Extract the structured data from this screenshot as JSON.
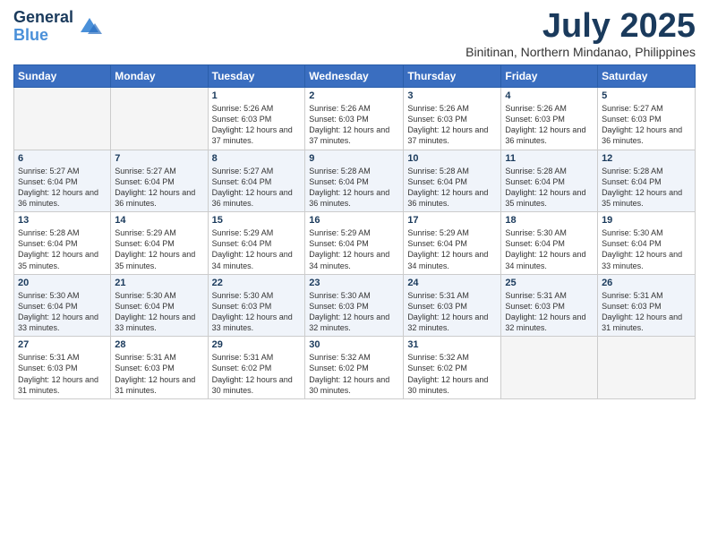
{
  "logo": {
    "line1": "General",
    "line2": "Blue"
  },
  "title": "July 2025",
  "location": "Binitinan, Northern Mindanao, Philippines",
  "weekdays": [
    "Sunday",
    "Monday",
    "Tuesday",
    "Wednesday",
    "Thursday",
    "Friday",
    "Saturday"
  ],
  "weeks": [
    [
      {
        "day": "",
        "sunrise": "",
        "sunset": "",
        "daylight": ""
      },
      {
        "day": "",
        "sunrise": "",
        "sunset": "",
        "daylight": ""
      },
      {
        "day": "1",
        "sunrise": "Sunrise: 5:26 AM",
        "sunset": "Sunset: 6:03 PM",
        "daylight": "Daylight: 12 hours and 37 minutes."
      },
      {
        "day": "2",
        "sunrise": "Sunrise: 5:26 AM",
        "sunset": "Sunset: 6:03 PM",
        "daylight": "Daylight: 12 hours and 37 minutes."
      },
      {
        "day": "3",
        "sunrise": "Sunrise: 5:26 AM",
        "sunset": "Sunset: 6:03 PM",
        "daylight": "Daylight: 12 hours and 37 minutes."
      },
      {
        "day": "4",
        "sunrise": "Sunrise: 5:26 AM",
        "sunset": "Sunset: 6:03 PM",
        "daylight": "Daylight: 12 hours and 36 minutes."
      },
      {
        "day": "5",
        "sunrise": "Sunrise: 5:27 AM",
        "sunset": "Sunset: 6:03 PM",
        "daylight": "Daylight: 12 hours and 36 minutes."
      }
    ],
    [
      {
        "day": "6",
        "sunrise": "Sunrise: 5:27 AM",
        "sunset": "Sunset: 6:04 PM",
        "daylight": "Daylight: 12 hours and 36 minutes."
      },
      {
        "day": "7",
        "sunrise": "Sunrise: 5:27 AM",
        "sunset": "Sunset: 6:04 PM",
        "daylight": "Daylight: 12 hours and 36 minutes."
      },
      {
        "day": "8",
        "sunrise": "Sunrise: 5:27 AM",
        "sunset": "Sunset: 6:04 PM",
        "daylight": "Daylight: 12 hours and 36 minutes."
      },
      {
        "day": "9",
        "sunrise": "Sunrise: 5:28 AM",
        "sunset": "Sunset: 6:04 PM",
        "daylight": "Daylight: 12 hours and 36 minutes."
      },
      {
        "day": "10",
        "sunrise": "Sunrise: 5:28 AM",
        "sunset": "Sunset: 6:04 PM",
        "daylight": "Daylight: 12 hours and 36 minutes."
      },
      {
        "day": "11",
        "sunrise": "Sunrise: 5:28 AM",
        "sunset": "Sunset: 6:04 PM",
        "daylight": "Daylight: 12 hours and 35 minutes."
      },
      {
        "day": "12",
        "sunrise": "Sunrise: 5:28 AM",
        "sunset": "Sunset: 6:04 PM",
        "daylight": "Daylight: 12 hours and 35 minutes."
      }
    ],
    [
      {
        "day": "13",
        "sunrise": "Sunrise: 5:28 AM",
        "sunset": "Sunset: 6:04 PM",
        "daylight": "Daylight: 12 hours and 35 minutes."
      },
      {
        "day": "14",
        "sunrise": "Sunrise: 5:29 AM",
        "sunset": "Sunset: 6:04 PM",
        "daylight": "Daylight: 12 hours and 35 minutes."
      },
      {
        "day": "15",
        "sunrise": "Sunrise: 5:29 AM",
        "sunset": "Sunset: 6:04 PM",
        "daylight": "Daylight: 12 hours and 34 minutes."
      },
      {
        "day": "16",
        "sunrise": "Sunrise: 5:29 AM",
        "sunset": "Sunset: 6:04 PM",
        "daylight": "Daylight: 12 hours and 34 minutes."
      },
      {
        "day": "17",
        "sunrise": "Sunrise: 5:29 AM",
        "sunset": "Sunset: 6:04 PM",
        "daylight": "Daylight: 12 hours and 34 minutes."
      },
      {
        "day": "18",
        "sunrise": "Sunrise: 5:30 AM",
        "sunset": "Sunset: 6:04 PM",
        "daylight": "Daylight: 12 hours and 34 minutes."
      },
      {
        "day": "19",
        "sunrise": "Sunrise: 5:30 AM",
        "sunset": "Sunset: 6:04 PM",
        "daylight": "Daylight: 12 hours and 33 minutes."
      }
    ],
    [
      {
        "day": "20",
        "sunrise": "Sunrise: 5:30 AM",
        "sunset": "Sunset: 6:04 PM",
        "daylight": "Daylight: 12 hours and 33 minutes."
      },
      {
        "day": "21",
        "sunrise": "Sunrise: 5:30 AM",
        "sunset": "Sunset: 6:04 PM",
        "daylight": "Daylight: 12 hours and 33 minutes."
      },
      {
        "day": "22",
        "sunrise": "Sunrise: 5:30 AM",
        "sunset": "Sunset: 6:03 PM",
        "daylight": "Daylight: 12 hours and 33 minutes."
      },
      {
        "day": "23",
        "sunrise": "Sunrise: 5:30 AM",
        "sunset": "Sunset: 6:03 PM",
        "daylight": "Daylight: 12 hours and 32 minutes."
      },
      {
        "day": "24",
        "sunrise": "Sunrise: 5:31 AM",
        "sunset": "Sunset: 6:03 PM",
        "daylight": "Daylight: 12 hours and 32 minutes."
      },
      {
        "day": "25",
        "sunrise": "Sunrise: 5:31 AM",
        "sunset": "Sunset: 6:03 PM",
        "daylight": "Daylight: 12 hours and 32 minutes."
      },
      {
        "day": "26",
        "sunrise": "Sunrise: 5:31 AM",
        "sunset": "Sunset: 6:03 PM",
        "daylight": "Daylight: 12 hours and 31 minutes."
      }
    ],
    [
      {
        "day": "27",
        "sunrise": "Sunrise: 5:31 AM",
        "sunset": "Sunset: 6:03 PM",
        "daylight": "Daylight: 12 hours and 31 minutes."
      },
      {
        "day": "28",
        "sunrise": "Sunrise: 5:31 AM",
        "sunset": "Sunset: 6:03 PM",
        "daylight": "Daylight: 12 hours and 31 minutes."
      },
      {
        "day": "29",
        "sunrise": "Sunrise: 5:31 AM",
        "sunset": "Sunset: 6:02 PM",
        "daylight": "Daylight: 12 hours and 30 minutes."
      },
      {
        "day": "30",
        "sunrise": "Sunrise: 5:32 AM",
        "sunset": "Sunset: 6:02 PM",
        "daylight": "Daylight: 12 hours and 30 minutes."
      },
      {
        "day": "31",
        "sunrise": "Sunrise: 5:32 AM",
        "sunset": "Sunset: 6:02 PM",
        "daylight": "Daylight: 12 hours and 30 minutes."
      },
      {
        "day": "",
        "sunrise": "",
        "sunset": "",
        "daylight": ""
      },
      {
        "day": "",
        "sunrise": "",
        "sunset": "",
        "daylight": ""
      }
    ]
  ]
}
